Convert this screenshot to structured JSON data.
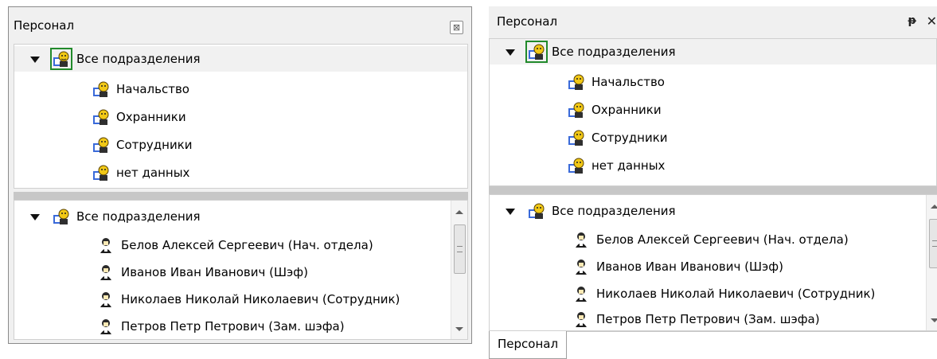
{
  "title": "Персонал",
  "top_tree": {
    "root": "Все подразделения",
    "children": [
      "Начальство",
      "Охранники",
      "Сотрудники",
      "нет данных"
    ]
  },
  "bottom_tree": {
    "root": "Все подразделения",
    "people": [
      "Белов Алексей Сергеевич (Нач. отдела)",
      "Иванов Иван Иванович (Шэф)",
      "Николаев Николай Николаевич (Сотрудник)",
      "Петров Петр Петрович (Зам. шэфа)"
    ]
  },
  "tab_label": "Персонал",
  "icons": {
    "close_small": "⊠",
    "pin": "ᵽ",
    "close": "✕"
  },
  "colors": {
    "selection_border": "#218a2b",
    "splitter": "#c7c7c7"
  }
}
